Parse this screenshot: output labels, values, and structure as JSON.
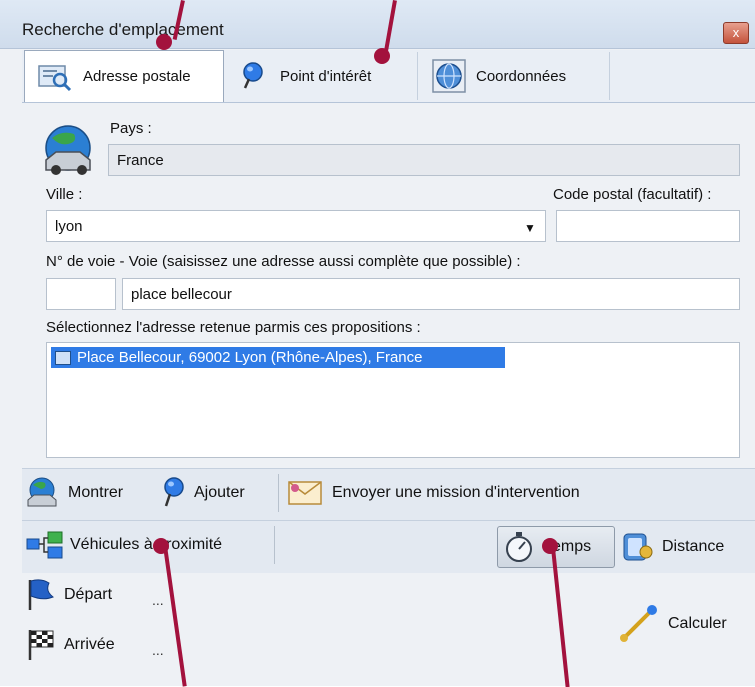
{
  "window": {
    "title": "Recherche d'emplacement",
    "close": "x"
  },
  "tabs": [
    {
      "label": "Adresse postale",
      "icon": "address-search-icon"
    },
    {
      "label": "Point d'intérêt",
      "icon": "map-pin-icon"
    },
    {
      "label": "Coordonnées",
      "icon": "globe-coordinates-icon"
    }
  ],
  "form": {
    "country_label": "Pays :",
    "country_value": "France",
    "city_label": "Ville :",
    "city_value": "lyon",
    "postal_label": "Code postal (facultatif) :",
    "postal_value": "",
    "street_label": "N° de voie - Voie (saisissez une adresse aussi complète que possible) :",
    "street_number": "",
    "street_value": "place bellecour",
    "suggestions_label": "Sélectionnez l'adresse retenue parmis ces propositions :",
    "suggestions": [
      "Place Bellecour, 69002 Lyon (Rhône-Alpes), France"
    ]
  },
  "actions": {
    "show": "Montrer",
    "add": "Ajouter",
    "mission": "Envoyer une mission d'intervention",
    "nearby": "Véhicules à proximité",
    "time": "Temps",
    "distance": "Distance",
    "start": "Départ",
    "start_value": "...",
    "arrival": "Arrivée",
    "arrival_value": "...",
    "calculate": "Calculer"
  },
  "colors": {
    "accent": "#2f7be6",
    "callout": "#a3123d"
  }
}
